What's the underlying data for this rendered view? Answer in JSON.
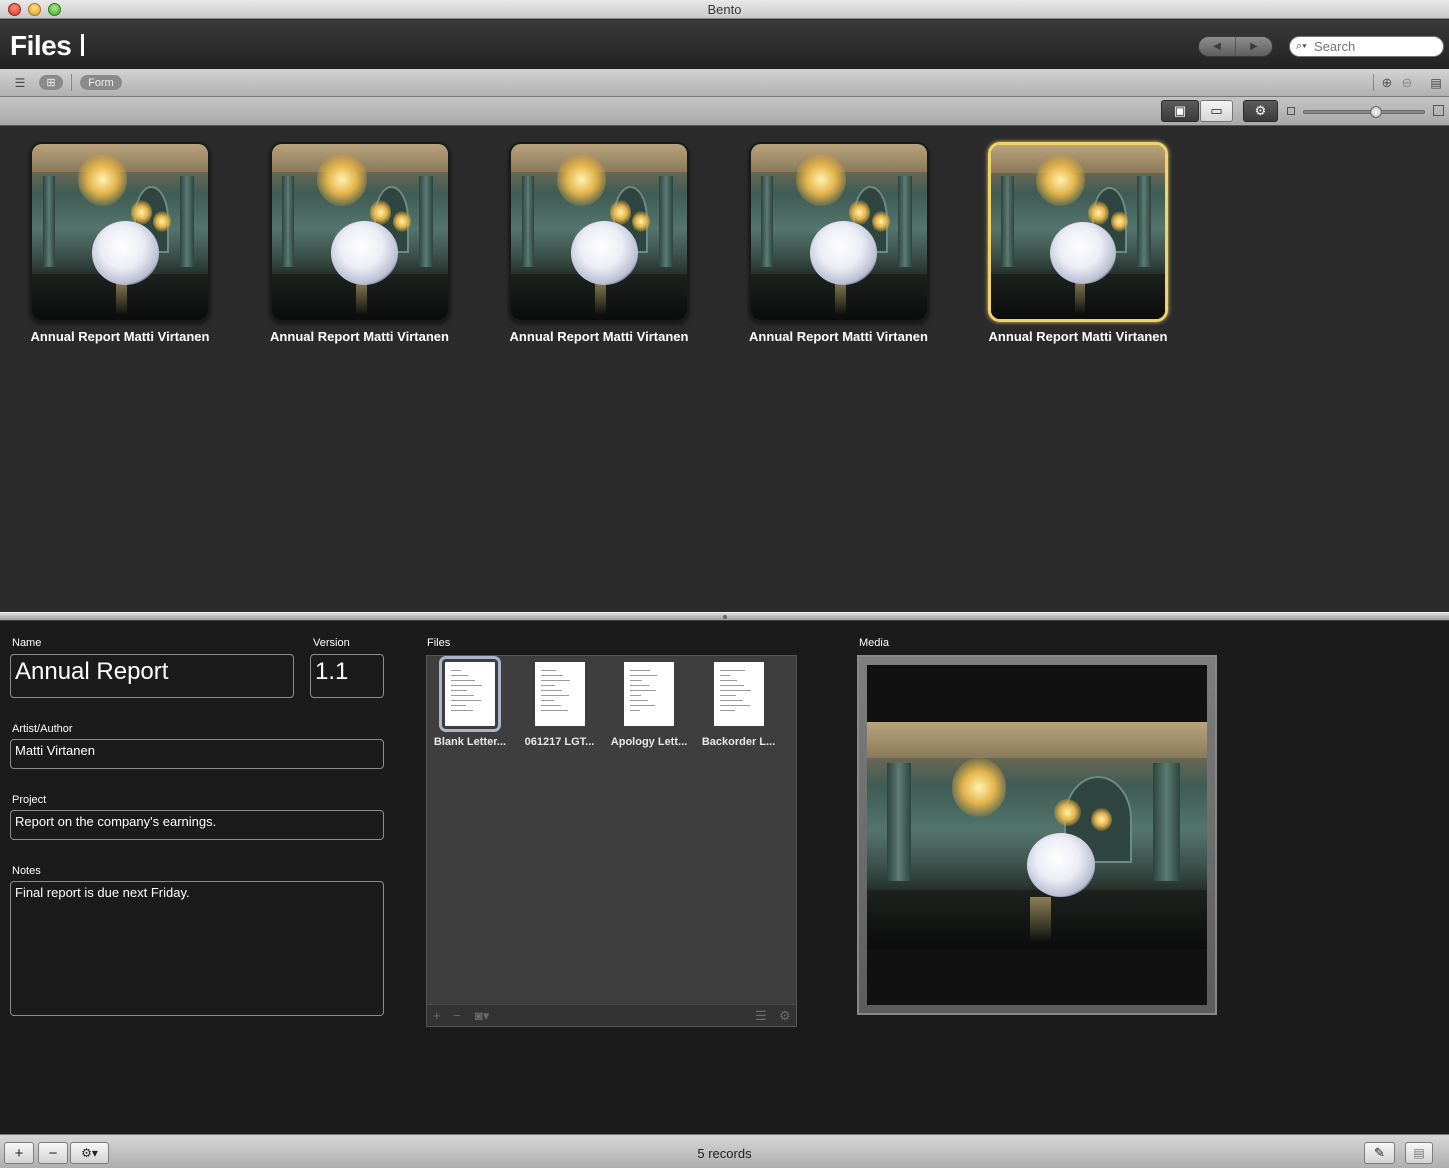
{
  "window": {
    "title": "Bento"
  },
  "header": {
    "title": "Files",
    "search_placeholder": "Search"
  },
  "view_toolbar": {
    "form_label": "Form"
  },
  "gallery": {
    "records": [
      {
        "caption": "Annual Report Matti Virtanen",
        "selected": false
      },
      {
        "caption": "Annual Report Matti Virtanen",
        "selected": false
      },
      {
        "caption": "Annual Report Matti Virtanen",
        "selected": false
      },
      {
        "caption": "Annual Report Matti Virtanen",
        "selected": false
      },
      {
        "caption": "Annual Report Matti Virtanen",
        "selected": true
      }
    ],
    "zoom_level": 0.6,
    "selected_color": "#f1d36c"
  },
  "form": {
    "name_label": "Name",
    "name_value": "Annual Report",
    "version_label": "Version",
    "version_value": "1.1",
    "author_label": "Artist/Author",
    "author_value": "Matti Virtanen",
    "project_label": "Project",
    "project_value": "Report on the company's earnings.",
    "notes_label": "Notes",
    "notes_value": "Final report is due next Friday.",
    "files_label": "Files",
    "files": [
      {
        "name": "Blank Letter...",
        "selected": true
      },
      {
        "name": "061217 LGT...",
        "selected": false
      },
      {
        "name": "Apology Lett...",
        "selected": false
      },
      {
        "name": "Backorder L...",
        "selected": false
      }
    ],
    "media_label": "Media"
  },
  "footer": {
    "records_text": "5 records"
  },
  "icons": {
    "back": "◀",
    "forward": "▶",
    "search": "🔍",
    "list": "☰",
    "grid": "⊞",
    "add": "+",
    "remove": "−",
    "gear": "⚙",
    "edit": "✎"
  }
}
